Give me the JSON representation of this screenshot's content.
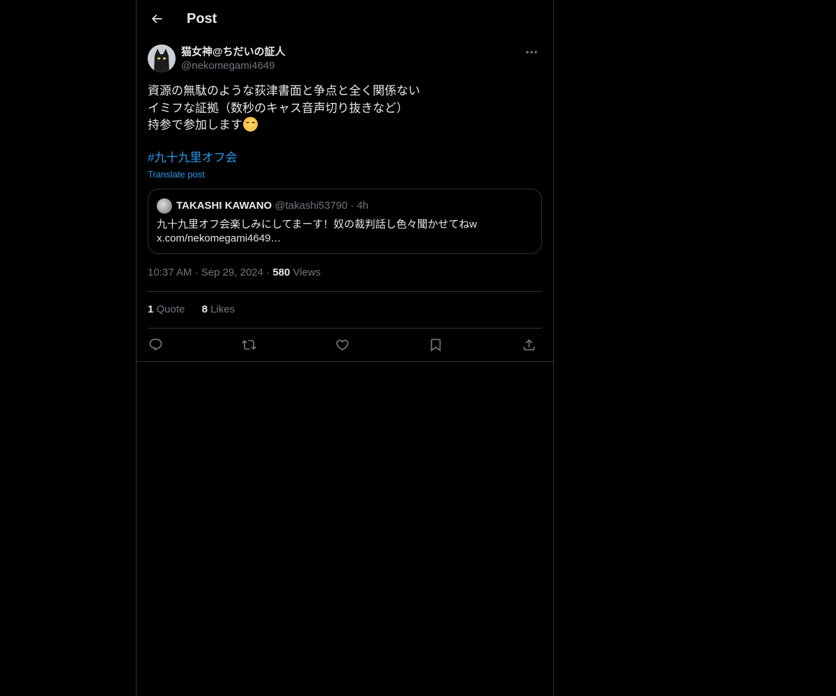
{
  "header": {
    "title": "Post",
    "back_icon": "arrow-left-icon"
  },
  "post": {
    "author": {
      "display_name": "猫女神@ちだいの証人",
      "handle": "@nekomegami4649"
    },
    "text_lines": [
      "資源の無駄のような荻津書面と争点と全く関係ない",
      "イミフな証拠（数秒のキャス音声切り抜きなど）",
      "持参で参加します"
    ],
    "emoji": "smiling-face-emoji",
    "hashtag": "#九十九里オフ会",
    "translate_label": "Translate post",
    "quote": {
      "display_name": "TAKASHI KAWANO",
      "handle": "@takashi53790",
      "separator": "·",
      "time": "4h",
      "text_lines": [
        "九十九里オフ会楽しみにしてまーす！奴の裁判話し色々聞かせてねw",
        "x.com/nekomegami4649…"
      ]
    },
    "timestamp": "10:37 AM",
    "date": "Sep 29, 2024",
    "separator": "·",
    "views_count": "580",
    "views_label": "Views",
    "stats": {
      "quotes_count": "1",
      "quotes_label": "Quote",
      "likes_count": "8",
      "likes_label": "Likes"
    }
  },
  "colors": {
    "background": "#000000",
    "text": "#e7e9ea",
    "muted": "#71767b",
    "accent": "#1d9bf0",
    "border": "#2f3336"
  }
}
